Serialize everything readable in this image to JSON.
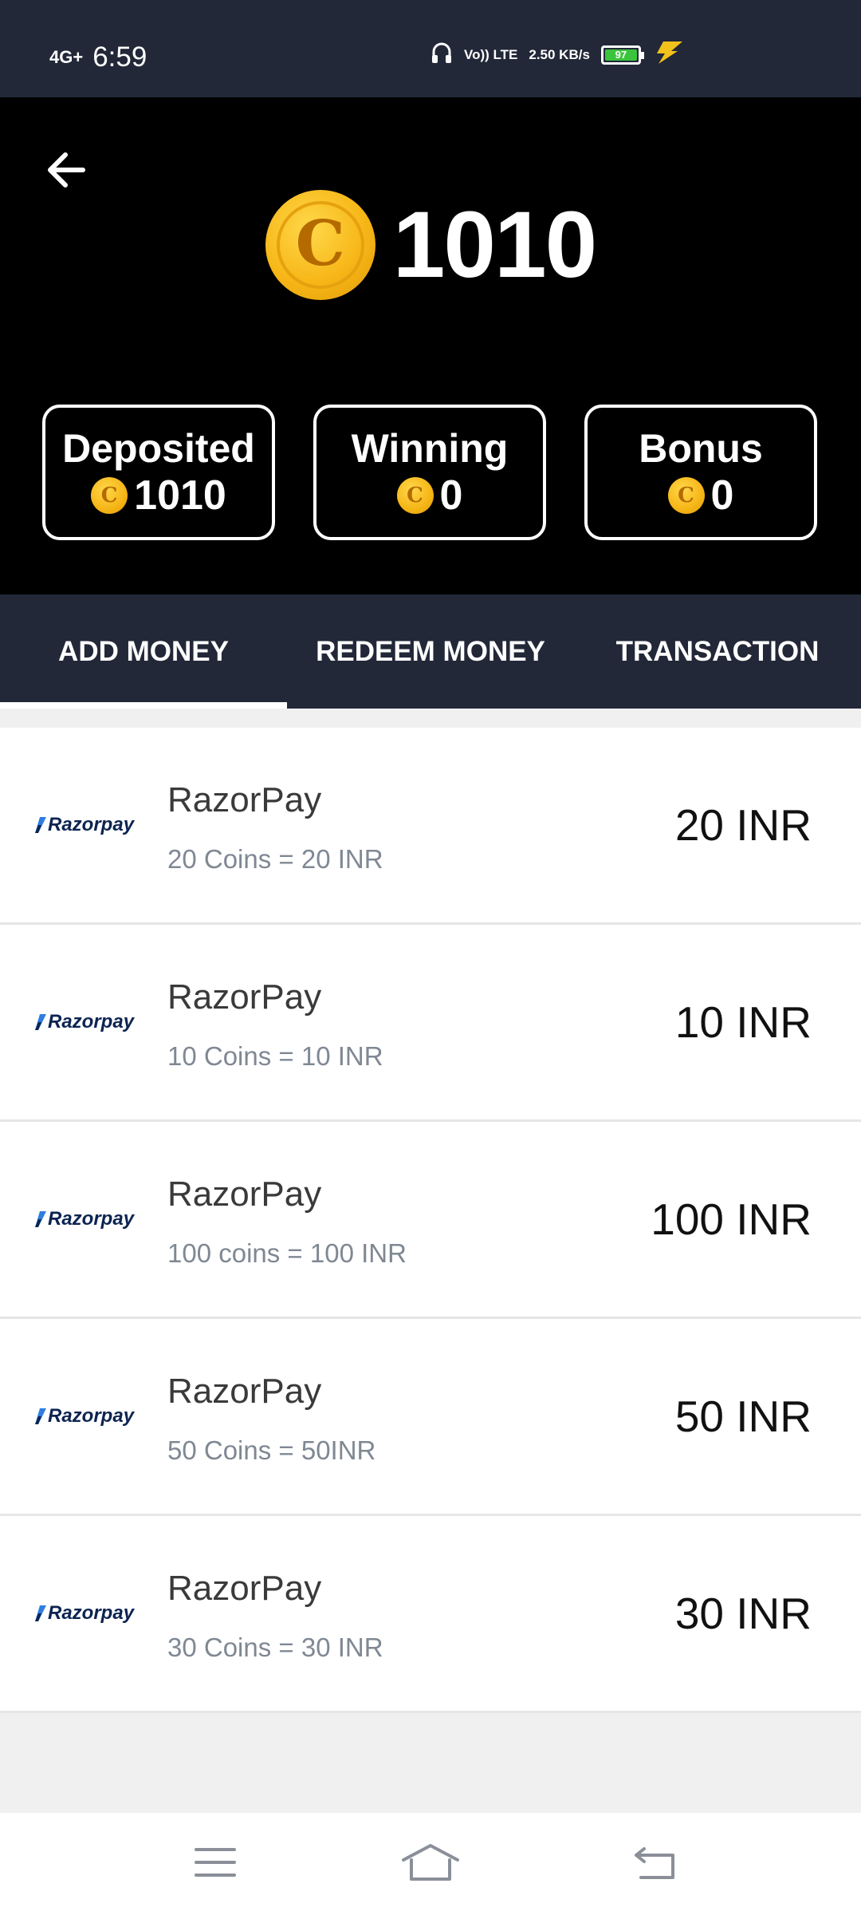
{
  "status_bar": {
    "network": "4G+",
    "time": "6:59",
    "volte": "Vo)) LTE",
    "speed": "2.50 KB/s",
    "battery": "97"
  },
  "header": {
    "balance": "1010",
    "coin_icon_letter": "C",
    "wallets": [
      {
        "label": "Deposited",
        "value": "1010"
      },
      {
        "label": "Winning",
        "value": "0"
      },
      {
        "label": "Bonus",
        "value": "0"
      }
    ]
  },
  "tabs": [
    {
      "label": "ADD MONEY",
      "active": true
    },
    {
      "label": "REDEEM MONEY",
      "active": false
    },
    {
      "label": "TRANSACTION",
      "active": false
    }
  ],
  "payment_options": [
    {
      "logo": "Razorpay",
      "title": "RazorPay",
      "subtitle": "20 Coins = 20 INR",
      "amount": "20 INR"
    },
    {
      "logo": "Razorpay",
      "title": "RazorPay",
      "subtitle": "10 Coins = 10 INR",
      "amount": "10 INR"
    },
    {
      "logo": "Razorpay",
      "title": "RazorPay",
      "subtitle": "100 coins = 100 INR",
      "amount": "100 INR"
    },
    {
      "logo": "Razorpay",
      "title": "RazorPay",
      "subtitle": "50 Coins = 50INR",
      "amount": "50 INR"
    },
    {
      "logo": "Razorpay",
      "title": "RazorPay",
      "subtitle": "30 Coins = 30 INR",
      "amount": "30 INR"
    }
  ],
  "colors": {
    "status_bar_bg": "#222838",
    "header_bg": "#000000",
    "coin_gold": "#f7b718",
    "tab_bar_bg": "#222838",
    "subtitle_gray": "#7f8893"
  },
  "nav_bar": {
    "icons": [
      "menu-icon",
      "home-icon",
      "back-icon"
    ]
  }
}
